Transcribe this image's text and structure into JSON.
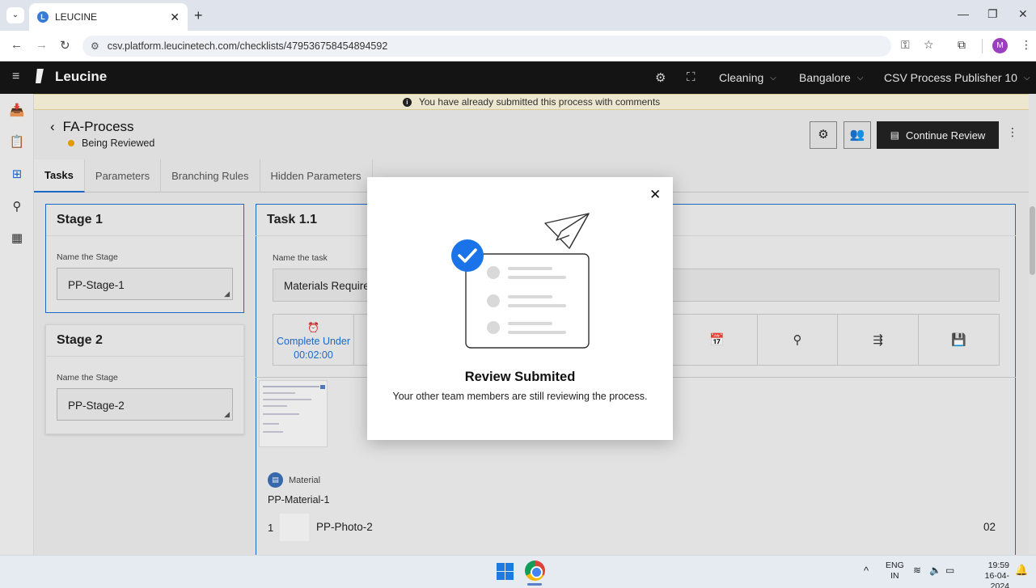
{
  "browser": {
    "tab_title": "LEUCINE",
    "tab_favicon": "L",
    "url": "csv.platform.leucinetech.com/checklists/479536758454894592",
    "profile_initial": "M",
    "icons": [
      "tab-search-icon",
      "back-icon",
      "forward-icon",
      "reload-icon",
      "site-settings-icon",
      "password-key-icon",
      "bookmark-star-icon",
      "extensions-icon",
      "more-menu-icon",
      "minimize-icon",
      "restore-icon",
      "close-icon"
    ]
  },
  "app": {
    "brand": "Leucine",
    "header": {
      "facility": "Cleaning",
      "location": "Bangalore",
      "user": "CSV Process Publisher 10"
    },
    "banner": "You have already submitted this process with comments",
    "process": {
      "title": "FA-Process",
      "status": "Being Reviewed",
      "status_color": "#f0a500",
      "continue_label": "Continue Review"
    },
    "tabs": [
      {
        "label": "Tasks",
        "active": true
      },
      {
        "label": "Parameters",
        "active": false
      },
      {
        "label": "Branching Rules",
        "active": false
      },
      {
        "label": "Hidden Parameters",
        "active": false
      }
    ],
    "stages": [
      {
        "title": "Stage 1",
        "field_label": "Name the Stage",
        "value": "PP-Stage-1",
        "selected": true
      },
      {
        "title": "Stage 2",
        "field_label": "Name the Stage",
        "value": "PP-Stage-2",
        "selected": false
      }
    ],
    "task": {
      "title": "Task 1.1",
      "field_label": "Name the task",
      "value": "Materials Require",
      "timer_label": "Complete Under",
      "timer_value": "00:02:00",
      "material_label": "Material",
      "material_name": "PP-Material-1",
      "row_index": "1",
      "row_name": "PP-Photo-2",
      "row_qty": "02"
    }
  },
  "modal": {
    "title": "Review Submited",
    "message": "Your other team members are still reviewing the process."
  },
  "taskbar": {
    "lang": "ENG",
    "region": "IN",
    "time": "19:59",
    "date": "16-04-2024"
  },
  "colors": {
    "accent": "#1d6fd6",
    "appbar": "#161616",
    "check": "#1a73e8"
  }
}
